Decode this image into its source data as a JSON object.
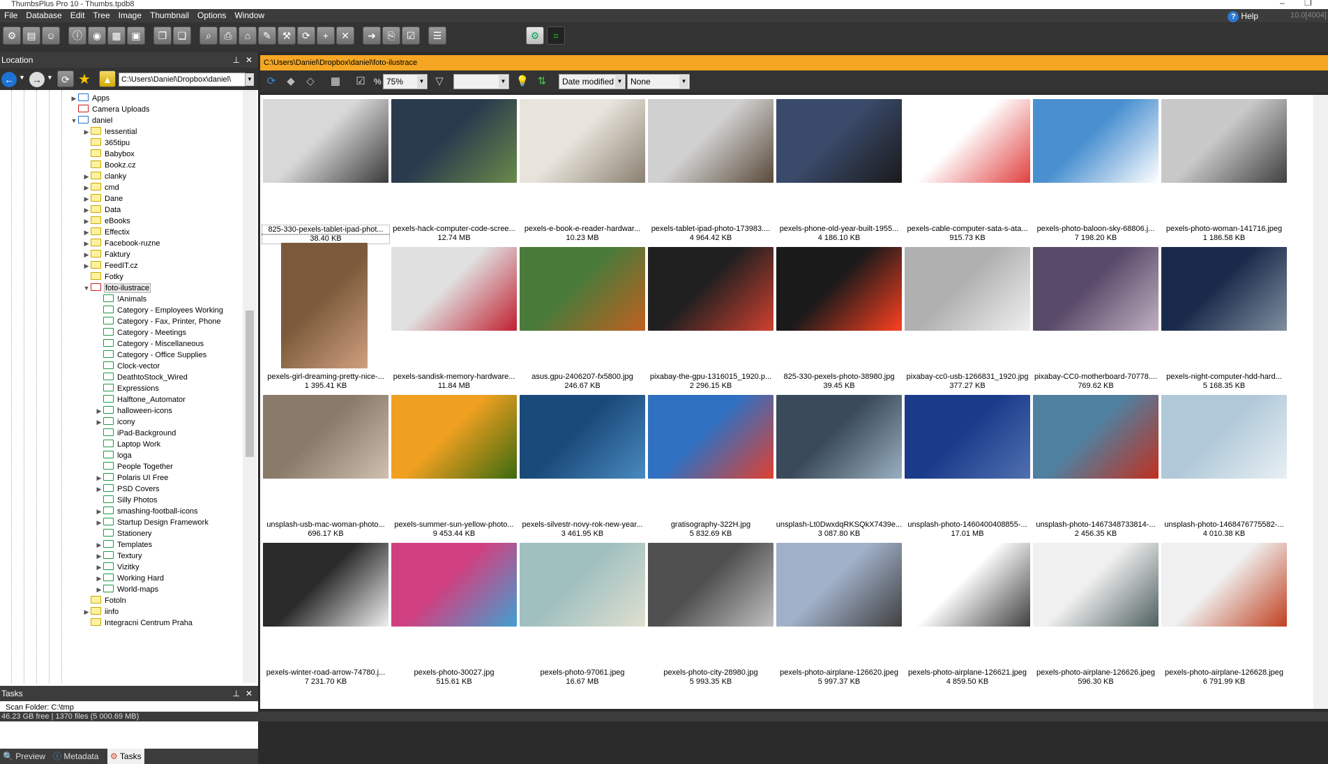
{
  "title": "ThumbsPlus Pro 10 - Thumbs.tpdb8",
  "menu": [
    "File",
    "Database",
    "Edit",
    "Tree",
    "Image",
    "Thumbnail",
    "Options",
    "Window"
  ],
  "help_label": "Help",
  "version": "10.0[4004]",
  "location_panel": {
    "title": "Location",
    "path": "C:\\Users\\Daniel\\Dropbox\\daniel\\"
  },
  "tree": [
    {
      "label": "Apps",
      "depth": 0,
      "expand": "closed",
      "folder": "blue"
    },
    {
      "label": "Camera Uploads",
      "depth": 0,
      "expand": "none",
      "folder": "red"
    },
    {
      "label": "daniel",
      "depth": 0,
      "expand": "open",
      "folder": "blue"
    },
    {
      "label": "!essential",
      "depth": 1,
      "expand": "closed",
      "folder": "yellow"
    },
    {
      "label": "365tipu",
      "depth": 1,
      "expand": "none",
      "folder": "yellow"
    },
    {
      "label": "Babybox",
      "depth": 1,
      "expand": "none",
      "folder": "yellow"
    },
    {
      "label": "Bookz.cz",
      "depth": 1,
      "expand": "none",
      "folder": "yellow"
    },
    {
      "label": "clanky",
      "depth": 1,
      "expand": "closed",
      "folder": "yellow"
    },
    {
      "label": "cmd",
      "depth": 1,
      "expand": "closed",
      "folder": "yellow"
    },
    {
      "label": "Dane",
      "depth": 1,
      "expand": "closed",
      "folder": "yellow"
    },
    {
      "label": "Data",
      "depth": 1,
      "expand": "closed",
      "folder": "yellow"
    },
    {
      "label": "eBooks",
      "depth": 1,
      "expand": "closed",
      "folder": "yellow"
    },
    {
      "label": "Effectix",
      "depth": 1,
      "expand": "closed",
      "folder": "yellow"
    },
    {
      "label": "Facebook-ruzne",
      "depth": 1,
      "expand": "closed",
      "folder": "yellow"
    },
    {
      "label": "Faktury",
      "depth": 1,
      "expand": "closed",
      "folder": "yellow"
    },
    {
      "label": "FeedIT.cz",
      "depth": 1,
      "expand": "closed",
      "folder": "yellow"
    },
    {
      "label": "Fotky",
      "depth": 1,
      "expand": "none",
      "folder": "yellow"
    },
    {
      "label": "foto-ilustrace",
      "depth": 1,
      "expand": "open",
      "folder": "red",
      "selected": true
    },
    {
      "label": "!Animals",
      "depth": 2,
      "expand": "none",
      "folder": "green"
    },
    {
      "label": "Category - Employees Working",
      "depth": 2,
      "expand": "none",
      "folder": "green"
    },
    {
      "label": "Category - Fax, Printer, Phone",
      "depth": 2,
      "expand": "none",
      "folder": "green"
    },
    {
      "label": "Category - Meetings",
      "depth": 2,
      "expand": "none",
      "folder": "green"
    },
    {
      "label": "Category - Miscellaneous",
      "depth": 2,
      "expand": "none",
      "folder": "green"
    },
    {
      "label": "Category - Office Supplies",
      "depth": 2,
      "expand": "none",
      "folder": "green"
    },
    {
      "label": "Clock-vector",
      "depth": 2,
      "expand": "none",
      "folder": "green"
    },
    {
      "label": "DeathtoStock_Wired",
      "depth": 2,
      "expand": "none",
      "folder": "green"
    },
    {
      "label": "Expressions",
      "depth": 2,
      "expand": "none",
      "folder": "green"
    },
    {
      "label": "Halftone_Automator",
      "depth": 2,
      "expand": "none",
      "folder": "green"
    },
    {
      "label": "halloween-icons",
      "depth": 2,
      "expand": "closed",
      "folder": "green"
    },
    {
      "label": "icony",
      "depth": 2,
      "expand": "closed",
      "folder": "green"
    },
    {
      "label": "iPad-Background",
      "depth": 2,
      "expand": "none",
      "folder": "green"
    },
    {
      "label": "Laptop Work",
      "depth": 2,
      "expand": "none",
      "folder": "green"
    },
    {
      "label": "loga",
      "depth": 2,
      "expand": "none",
      "folder": "green"
    },
    {
      "label": "People Together",
      "depth": 2,
      "expand": "none",
      "folder": "green"
    },
    {
      "label": "Polaris UI Free",
      "depth": 2,
      "expand": "closed",
      "folder": "green"
    },
    {
      "label": "PSD Covers",
      "depth": 2,
      "expand": "closed",
      "folder": "green"
    },
    {
      "label": "Silly Photos",
      "depth": 2,
      "expand": "none",
      "folder": "green"
    },
    {
      "label": "smashing-football-icons",
      "depth": 2,
      "expand": "closed",
      "folder": "green"
    },
    {
      "label": "Startup Design Framework",
      "depth": 2,
      "expand": "closed",
      "folder": "green"
    },
    {
      "label": "Stationery",
      "depth": 2,
      "expand": "none",
      "folder": "green"
    },
    {
      "label": "Templates",
      "depth": 2,
      "expand": "closed",
      "folder": "green"
    },
    {
      "label": "Textury",
      "depth": 2,
      "expand": "closed",
      "folder": "green"
    },
    {
      "label": "Vizitky",
      "depth": 2,
      "expand": "closed",
      "folder": "green"
    },
    {
      "label": "Working Hard",
      "depth": 2,
      "expand": "closed",
      "folder": "green"
    },
    {
      "label": "World-maps",
      "depth": 2,
      "expand": "closed",
      "folder": "green"
    },
    {
      "label": "Fotoln",
      "depth": 1,
      "expand": "none",
      "folder": "yellow"
    },
    {
      "label": "iinfo",
      "depth": 1,
      "expand": "closed",
      "folder": "yellow"
    },
    {
      "label": "Integracni Centrum Praha",
      "depth": 1,
      "expand": "none",
      "folder": "yellow"
    }
  ],
  "tasks": {
    "title": "Tasks",
    "items": [
      "Scan Folder: C:\\tmp"
    ]
  },
  "left_tabs": [
    "Preview",
    "Metadata",
    "Tasks"
  ],
  "left_tab_active": "Tasks",
  "browser": {
    "path": "C:\\Users\\Daniel\\Dropbox\\daniel\\foto-ilustrace",
    "zoom_unit": "%",
    "zoom": "75%",
    "filter": "",
    "sort": "Date modified",
    "group": "None"
  },
  "thumbnails": [
    {
      "name": "825-330-pexels-tablet-ipad-phot...",
      "size": "38.40 KB",
      "colors": [
        "#d8d8d8",
        "#3a3a3a"
      ],
      "selected": true
    },
    {
      "name": "pexels-hack-computer-code-scree...",
      "size": "12.74 MB",
      "colors": [
        "#2a3b4e",
        "#6a8a4a"
      ]
    },
    {
      "name": "pexels-e-book-e-reader-hardwar...",
      "size": "10.23 MB",
      "colors": [
        "#e8e4dc",
        "#8a8070"
      ]
    },
    {
      "name": "pexels-tablet-ipad-photo-173983....",
      "size": "4 964.42 KB",
      "colors": [
        "#d0d0d0",
        "#5a4a3a"
      ]
    },
    {
      "name": "pexels-phone-old-year-built-1955...",
      "size": "4 186.10 KB",
      "colors": [
        "#3a4a6a",
        "#1a1a1a"
      ]
    },
    {
      "name": "pexels-cable-computer-sata-s-ata...",
      "size": "915.73 KB",
      "colors": [
        "#ffffff",
        "#e04040"
      ]
    },
    {
      "name": "pexels-photo-baloon-sky-68806.j...",
      "size": "7 198.20 KB",
      "colors": [
        "#4a90d0",
        "#ffffff"
      ]
    },
    {
      "name": "pexels-photo-woman-141716.jpeg",
      "size": "1 186.58 KB",
      "colors": [
        "#c8c8c8",
        "#404040"
      ]
    },
    {
      "name": "pexels-girl-dreaming-pretty-nice-...",
      "size": "1 395.41 KB",
      "colors": [
        "#7a5a3a",
        "#d0a080"
      ]
    },
    {
      "name": "pexels-sandisk-memory-hardware...",
      "size": "11.84 MB",
      "colors": [
        "#e0e0e0",
        "#c02030"
      ]
    },
    {
      "name": "asus.gpu-2406207-fx5800.jpg",
      "size": "246.67 KB",
      "colors": [
        "#4a7a3a",
        "#c06020"
      ]
    },
    {
      "name": "pixabay-the-gpu-1316015_1920.p...",
      "size": "2 296.15 KB",
      "colors": [
        "#202020",
        "#d04030"
      ]
    },
    {
      "name": "825-330-pexels-photo-38980.jpg",
      "size": "39.45 KB",
      "colors": [
        "#1a1a1a",
        "#ff4020"
      ]
    },
    {
      "name": "pixabay-cc0-usb-1266831_1920.jpg",
      "size": "377.27 KB",
      "colors": [
        "#b0b0b0",
        "#f0f0f0"
      ]
    },
    {
      "name": "pixabay-CC0-motherboard-70778....",
      "size": "769.62 KB",
      "colors": [
        "#5a4a6a",
        "#c0b0c0"
      ]
    },
    {
      "name": "pexels-night-computer-hdd-hard...",
      "size": "5 168.35 KB",
      "colors": [
        "#1a2a4a",
        "#8090a0"
      ]
    },
    {
      "name": "unsplash-usb-mac-woman-photo...",
      "size": "696.17 KB",
      "colors": [
        "#8a7a6a",
        "#d0c0b0"
      ]
    },
    {
      "name": "pexels-summer-sun-yellow-photo...",
      "size": "9 453.44 KB",
      "colors": [
        "#f0a020",
        "#3a6a10"
      ]
    },
    {
      "name": "pexels-silvestr-novy-rok-new-year...",
      "size": "3 461.95 KB",
      "colors": [
        "#1a4a7a",
        "#4a8ac0"
      ]
    },
    {
      "name": "gratisography-322H.jpg",
      "size": "5 832.69 KB",
      "colors": [
        "#3070c0",
        "#e04030"
      ]
    },
    {
      "name": "unsplash-Lt0DwxdqRKSQkX7439e...",
      "size": "3 087.80 KB",
      "colors": [
        "#3a4a5a",
        "#9ab0c0"
      ]
    },
    {
      "name": "unsplash-photo-1460400408855-...",
      "size": "17.01 MB",
      "colors": [
        "#1a3a8a",
        "#5070b0"
      ]
    },
    {
      "name": "unsplash-photo-1467348733814-...",
      "size": "2 456.35 KB",
      "colors": [
        "#5080a0",
        "#c03020"
      ]
    },
    {
      "name": "unsplash-photo-1468476775582-...",
      "size": "4 010.38 KB",
      "colors": [
        "#b0c8d8",
        "#e8f0f4"
      ]
    },
    {
      "name": "pexels-winter-road-arrow-74780.j...",
      "size": "7 231.70 KB",
      "colors": [
        "#2a2a2a",
        "#f0f0f0"
      ]
    },
    {
      "name": "pexels-photo-30027.jpg",
      "size": "515.61 KB",
      "colors": [
        "#d04080",
        "#40a0d0"
      ]
    },
    {
      "name": "pexels-photo-97061.jpeg",
      "size": "16.67 MB",
      "colors": [
        "#a0c0c0",
        "#e0e0d0"
      ]
    },
    {
      "name": "pexels-photo-city-28980.jpg",
      "size": "5 993.35 KB",
      "colors": [
        "#505050",
        "#c0c0c0"
      ]
    },
    {
      "name": "pexels-photo-airplane-126620.jpeg",
      "size": "5 997.37 KB",
      "colors": [
        "#a0b0c8",
        "#404040"
      ]
    },
    {
      "name": "pexels-photo-airplane-126621.jpeg",
      "size": "4 859.50 KB",
      "colors": [
        "#ffffff",
        "#404040"
      ]
    },
    {
      "name": "pexels-photo-airplane-126626.jpeg",
      "size": "596.30 KB",
      "colors": [
        "#f0f0f0",
        "#506060"
      ]
    },
    {
      "name": "pexels-photo-airplane-126628.jpeg",
      "size": "6 791.99 KB",
      "colors": [
        "#f0f0f0",
        "#c04020"
      ]
    }
  ],
  "status": "46.23 GB free | 1370 files (5 000.69 MB)"
}
